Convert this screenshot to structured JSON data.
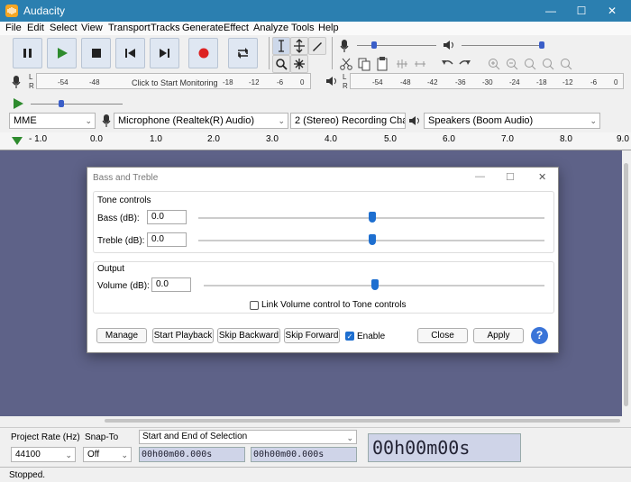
{
  "window": {
    "title": "Audacity"
  },
  "menu": [
    "File",
    "Edit",
    "Select",
    "View",
    "Transport",
    "Tracks",
    "Generate",
    "Effect",
    "Analyze",
    "Tools",
    "Help"
  ],
  "meters": {
    "record_ticks": [
      "-54",
      "-48",
      "Click to Start Monitoring",
      "-18",
      "-12",
      "-6",
      "0"
    ],
    "play_ticks": [
      "-54",
      "-48",
      "-42",
      "-36",
      "-30",
      "-24",
      "-18",
      "-12",
      "-6",
      "0"
    ],
    "channel_l": "L",
    "channel_r": "R"
  },
  "device": {
    "host": "MME",
    "mic": "Microphone (Realtek(R) Audio)",
    "channels": "2 (Stereo) Recording Chann",
    "speakers": "Speakers (Boom Audio)"
  },
  "timeline": [
    "- 1.0",
    "0.0",
    "1.0",
    "2.0",
    "3.0",
    "4.0",
    "5.0",
    "6.0",
    "7.0",
    "8.0",
    "9.0"
  ],
  "dialog": {
    "title": "Bass and Treble",
    "tone_group": "Tone controls",
    "bass_label": "Bass (dB):",
    "bass_value": "0.0",
    "treble_label": "Treble (dB):",
    "treble_value": "0.0",
    "output_group": "Output",
    "volume_label": "Volume (dB):",
    "volume_value": "0.0",
    "link_label": "Link Volume control to Tone controls",
    "buttons": {
      "manage": "Manage",
      "start": "Start Playback",
      "skip_back": "Skip Backward",
      "skip_fwd": "Skip Forward",
      "enable": "Enable",
      "close": "Close",
      "apply": "Apply",
      "help": "?"
    }
  },
  "bottom": {
    "rate_label": "Project Rate (Hz)",
    "rate_value": "44100",
    "snap_label": "Snap-To",
    "snap_value": "Off",
    "sel_label": "Start and End of Selection",
    "sel_start": "00h00m00.000s",
    "sel_end": "00h00m00.000s",
    "big_time": "00h00m00s"
  },
  "status": "Stopped."
}
